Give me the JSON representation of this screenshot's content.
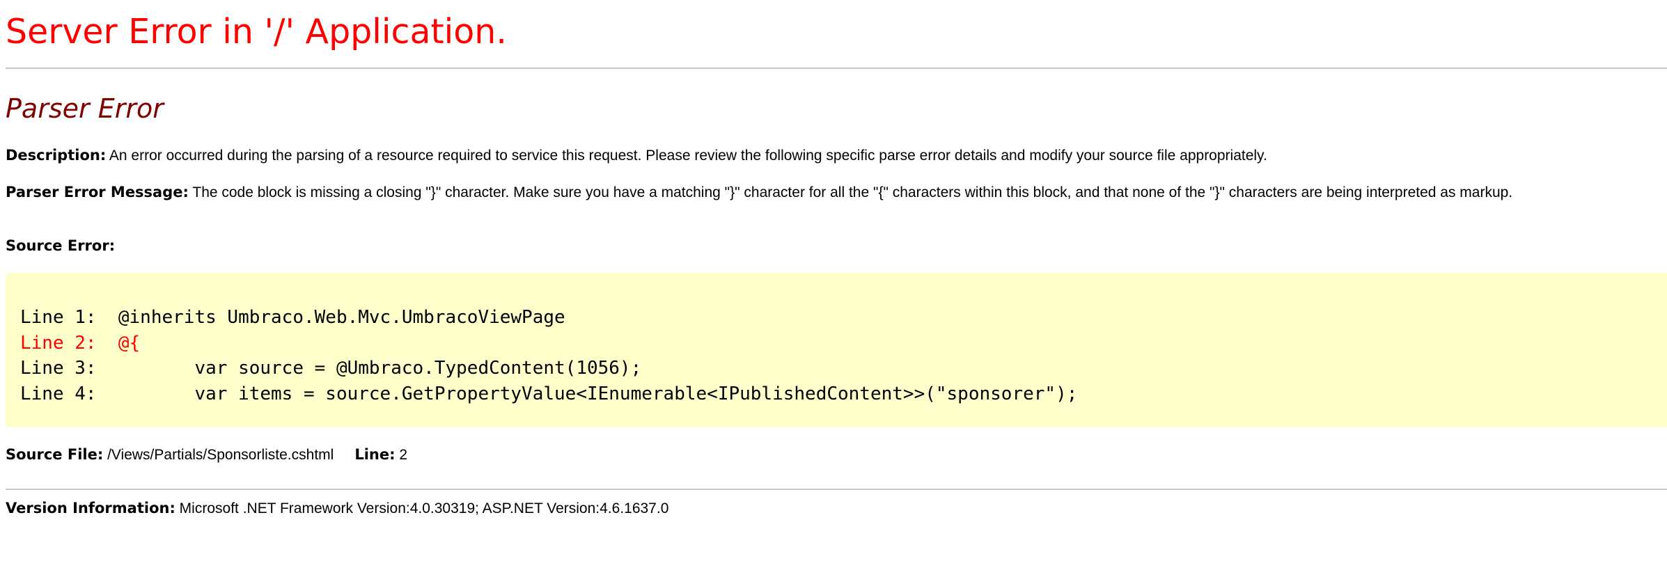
{
  "page": {
    "title": "Server Error in '/' Application.",
    "subtitle": "Parser Error"
  },
  "description": {
    "label": "Description:",
    "text": " An error occurred during the parsing of a resource required to service this request. Please review the following specific parse error details and modify your source file appropriately."
  },
  "parser_message": {
    "label": "Parser Error Message:",
    "text": " The code block is missing a closing \"}\" character.  Make sure you have a matching \"}\" character for all the \"{\" characters within this block, and that none of the \"}\" characters are being interpreted as markup."
  },
  "source_error": {
    "label": "Source Error:",
    "lines": [
      {
        "text": "Line 1:  @inherits Umbraco.Web.Mvc.UmbracoViewPage",
        "highlighted": false
      },
      {
        "text": "Line 2:  @{",
        "highlighted": true
      },
      {
        "text": "Line 3:         var source = @Umbraco.TypedContent(1056);",
        "highlighted": false
      },
      {
        "text": "Line 4:         var items = source.GetPropertyValue<IEnumerable<IPublishedContent>>(\"sponsorer\");",
        "highlighted": false
      }
    ]
  },
  "source_file": {
    "label": "Source File:",
    "path": " /Views/Partials/Sponsorliste.cshtml",
    "line_label": "Line:",
    "line_value": " 2"
  },
  "version": {
    "label": "Version Information:",
    "text": " Microsoft .NET Framework Version:4.0.30319; ASP.NET Version:4.6.1637.0"
  },
  "colors": {
    "title": "#ff0000",
    "subtitle": "#800000",
    "code_background": "#ffffcc",
    "error_line": "#ff0000",
    "rule": "#c8c8c8"
  }
}
